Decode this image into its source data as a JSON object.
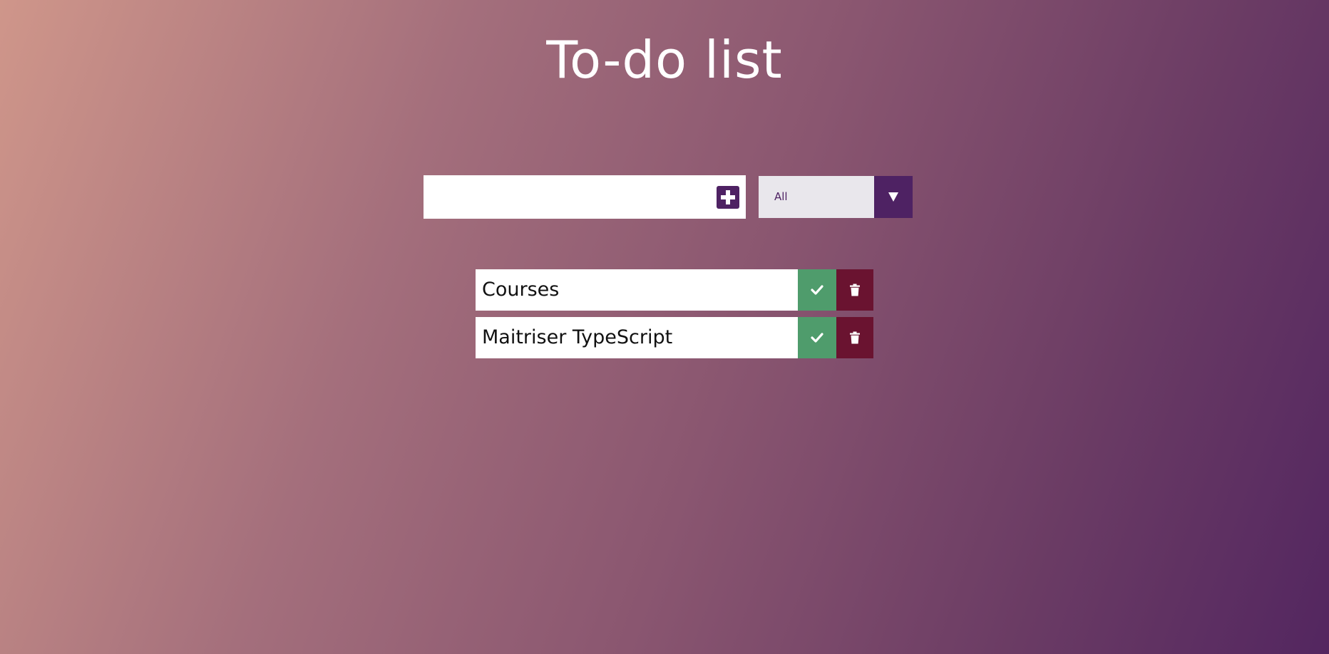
{
  "header": {
    "title": "To-do list"
  },
  "form": {
    "input_value": "",
    "input_placeholder": "",
    "add_icon": "plus-square-icon",
    "filter": {
      "selected": "All",
      "arrow_icon": "caret-down-icon"
    }
  },
  "todos": [
    {
      "text": "Courses",
      "complete_icon": "check-icon",
      "delete_icon": "trash-icon"
    },
    {
      "text": "Maitriser TypeScript",
      "complete_icon": "check-icon",
      "delete_icon": "trash-icon"
    }
  ],
  "colors": {
    "accent": "#4e2263",
    "complete": "#4f9c6c",
    "delete": "#6a1330",
    "gradient_start": "#cf968a",
    "gradient_end": "#532660"
  }
}
